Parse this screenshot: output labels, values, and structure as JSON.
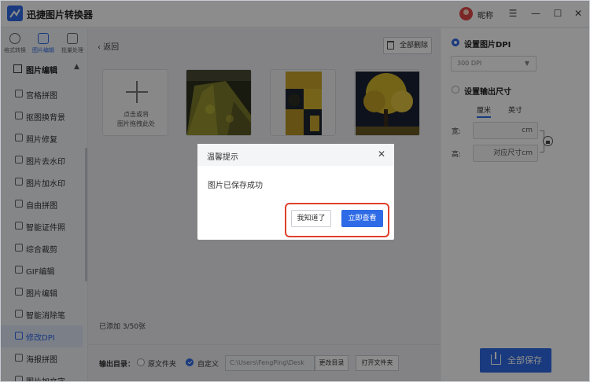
{
  "app": {
    "title": "迅捷图片转换器",
    "user_name": "昵称"
  },
  "topnav": [
    {
      "label": "格式转换",
      "active": false
    },
    {
      "label": "图片编辑",
      "active": true
    },
    {
      "label": "批量处理",
      "active": false
    }
  ],
  "sidebar": {
    "section_label": "图片编辑",
    "items": [
      {
        "label": "宫格拼图",
        "active": false
      },
      {
        "label": "抠图换背景",
        "active": false
      },
      {
        "label": "照片修复",
        "active": false
      },
      {
        "label": "图片去水印",
        "active": false
      },
      {
        "label": "图片加水印",
        "active": false
      },
      {
        "label": "自由拼图",
        "active": false
      },
      {
        "label": "智能证件照",
        "active": false
      },
      {
        "label": "综合裁剪",
        "active": false
      },
      {
        "label": "GIF编辑",
        "active": false
      },
      {
        "label": "图片编辑",
        "active": false
      },
      {
        "label": "智能消除笔",
        "active": false
      },
      {
        "label": "修改DPI",
        "active": true
      },
      {
        "label": "海报拼图",
        "active": false
      },
      {
        "label": "图片加文字",
        "active": false
      }
    ]
  },
  "main": {
    "back_label": "返回",
    "clear_all_label": "全部删除",
    "add_card_text_1": "点击或将",
    "add_card_text_2": "图片拖拽此处",
    "added_count": "已添加 3/50张"
  },
  "output": {
    "label": "输出目录：",
    "option_original": "原文件夹",
    "option_custom": "自定义",
    "selected": "自定义",
    "path_value": "C:\\Users\\FengPing\\Desk",
    "change_dir_label": "更改目录",
    "open_folder_label": "打开文件夹"
  },
  "right": {
    "dpi_title": "设置图片DPI",
    "dpi_value": "300 DPI",
    "size_title": "设置输出尺寸",
    "unit_cm": "厘米",
    "unit_inch": "英寸",
    "active_unit": "厘米",
    "width_label": "宽:",
    "width_unit": "cm",
    "height_label": "高:",
    "height_value": "对应尺寸cm",
    "save_all_label": "全部保存"
  },
  "dialog": {
    "title": "温馨提示",
    "message": "图片已保存成功",
    "ok_label": "我知道了",
    "view_label": "立即查看"
  },
  "colors": {
    "accent": "#2f6be6",
    "highlight_frame": "#e0402c"
  },
  "icons": [
    "logo-icon",
    "avatar-icon",
    "menu-icon",
    "minimize-icon",
    "maximize-icon",
    "close-icon",
    "plus-icon",
    "trash-icon",
    "lock-icon",
    "download-icon"
  ]
}
